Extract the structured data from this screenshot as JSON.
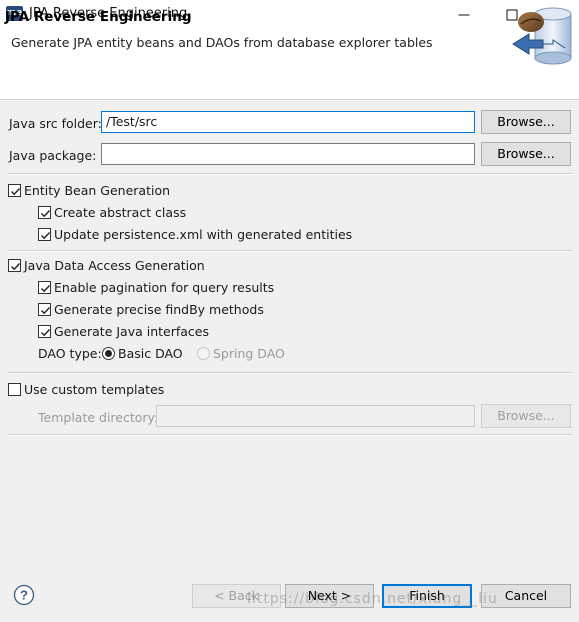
{
  "window": {
    "app_badge": "me",
    "title": "JPA Reverse Engineering"
  },
  "banner": {
    "title": "JPA Reverse Engineering",
    "description": "Generate JPA entity beans and DAOs from database explorer tables"
  },
  "form": {
    "src_folder_label": "Java src folder:",
    "src_folder_value": "/Test/src",
    "package_label": "Java package:",
    "package_value": "",
    "browse_label": "Browse..."
  },
  "entity_gen": {
    "label": "Entity Bean Generation",
    "checked": true,
    "options": [
      {
        "label": "Create abstract class",
        "checked": true
      },
      {
        "label": "Update persistence.xml with generated entities",
        "checked": true
      }
    ]
  },
  "dao_gen": {
    "label": "Java Data Access Generation",
    "checked": true,
    "options": [
      {
        "label": "Enable pagination for query results",
        "checked": true
      },
      {
        "label": "Generate precise findBy methods",
        "checked": true
      },
      {
        "label": "Generate Java interfaces",
        "checked": true
      }
    ],
    "dao_type_label": "DAO type:",
    "dao_types": [
      {
        "label": "Basic DAO",
        "selected": true
      },
      {
        "label": "Spring DAO",
        "selected": false
      }
    ]
  },
  "templates": {
    "label": "Use custom templates",
    "checked": false,
    "dir_label": "Template directory:",
    "dir_value": "",
    "browse_label": "Browse..."
  },
  "footer": {
    "back_label": "< Back",
    "next_label": "Next >",
    "finish_label": "Finish",
    "cancel_label": "Cancel",
    "watermark": "https://blog.csdn.net/xiang__liu"
  },
  "colors": {
    "accent": "#0078d7",
    "badge": "#2b4a7c"
  }
}
